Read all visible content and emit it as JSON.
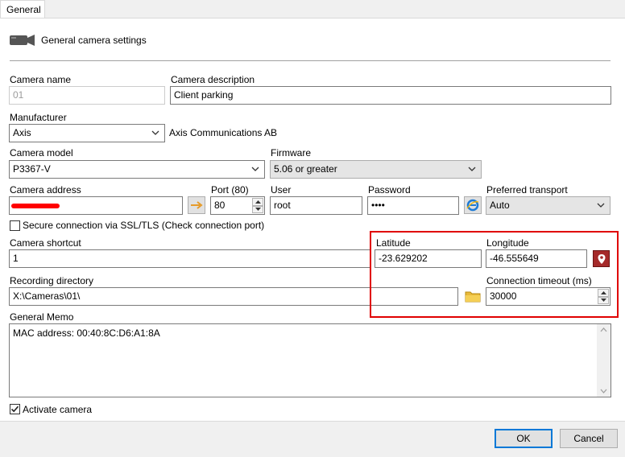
{
  "tabs": [
    {
      "label": "General"
    }
  ],
  "section": {
    "title": "General camera settings",
    "icon": "camera-icon"
  },
  "camera_name": {
    "label": "Camera name",
    "value": "01"
  },
  "camera_description": {
    "label": "Camera description",
    "value": "Client parking"
  },
  "manufacturer": {
    "label": "Manufacturer",
    "value": "Axis",
    "full_name": "Axis Communications AB"
  },
  "camera_model": {
    "label": "Camera model",
    "value": "P3367-V"
  },
  "firmware": {
    "label": "Firmware",
    "value": "5.06 or greater"
  },
  "camera_address": {
    "label": "Camera address"
  },
  "port": {
    "label": "Port (80)",
    "value": "80"
  },
  "user": {
    "label": "User",
    "value": "root"
  },
  "password": {
    "label": "Password",
    "value": "••••"
  },
  "preferred_transport": {
    "label": "Preferred transport",
    "value": "Auto"
  },
  "secure_connection": {
    "label": "Secure connection via SSL/TLS (Check connection port)",
    "checked": false
  },
  "camera_shortcut": {
    "label": "Camera shortcut",
    "value": "1"
  },
  "latitude": {
    "label": "Latitude",
    "value": "-23.629202"
  },
  "longitude": {
    "label": "Longitude",
    "value": "-46.555649"
  },
  "recording_directory": {
    "label": "Recording directory",
    "value": "X:\\Cameras\\01\\"
  },
  "connection_timeout": {
    "label": "Connection timeout (ms)",
    "value": "30000"
  },
  "general_memo": {
    "label": "General Memo",
    "value": "MAC address: 00:40:8C:D6:A1:8A"
  },
  "activate_camera": {
    "label": "Activate camera",
    "checked": true
  },
  "footer": {
    "ok_label": "OK",
    "cancel_label": "Cancel"
  },
  "colors": {
    "highlight": "#e00000",
    "focus": "#0078d7",
    "redaction": "#ff0000"
  }
}
